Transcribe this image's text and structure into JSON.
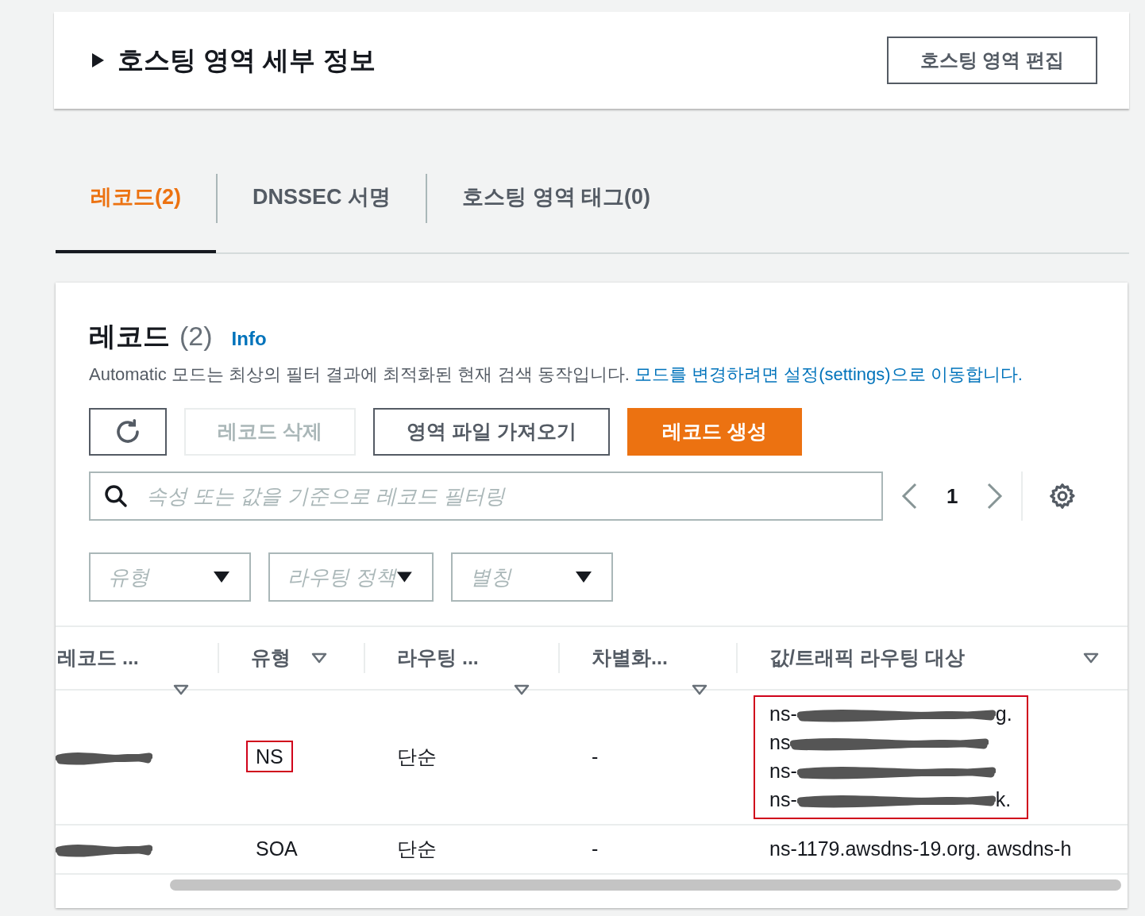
{
  "header": {
    "title": "호스팅 영역 세부 정보",
    "expanded": false,
    "edit_button": "호스팅 영역 편집"
  },
  "tabs": [
    {
      "label": "레코드(2)",
      "selected": true
    },
    {
      "label": "DNSSEC 서명",
      "selected": false
    },
    {
      "label": "호스팅 영역 태그(0)",
      "selected": false
    }
  ],
  "records": {
    "title": "레코드",
    "count": "(2)",
    "info": "Info",
    "description": "Automatic 모드는 최상의 필터 결과에 최적화된 현재 검색 동작입니다.",
    "description_link": "모드를 변경하려면 설정(settings)으로 이동합니다.",
    "buttons": [
      {
        "kind": "refresh",
        "disabled": false
      },
      {
        "kind": "text",
        "label": "레코드 삭제",
        "disabled": true
      },
      {
        "kind": "text",
        "label": "영역 파일 가져오기",
        "disabled": false
      },
      {
        "kind": "primary",
        "label": "레코드 생성",
        "disabled": false
      }
    ],
    "search": {
      "placeholder": "속성 또는 값을 기준으로 레코드 필터링"
    },
    "page": "1",
    "filters": [
      {
        "placeholder": "유형"
      },
      {
        "placeholder": "라우팅 정책"
      },
      {
        "placeholder": "별칭"
      }
    ],
    "columns": [
      {
        "label": "레코드 ..."
      },
      {
        "label": "유형"
      },
      {
        "label": "라우팅 ..."
      },
      {
        "label": "차별화..."
      },
      {
        "label": "값/트래픽 라우팅 대상"
      }
    ],
    "rows": [
      {
        "name_redacted": true,
        "type": "NS",
        "type_highlighted": true,
        "routing": "단순",
        "differentiator": "-",
        "value_highlighted": true,
        "values": [
          {
            "prefix": "ns-",
            "redacted": true,
            "suffix": "g."
          },
          {
            "prefix": "ns",
            "redacted": true
          },
          {
            "prefix": "ns-",
            "redacted": true
          },
          {
            "prefix": "ns-",
            "redacted": true,
            "suffix": "k."
          }
        ]
      },
      {
        "name_redacted": true,
        "type": "SOA",
        "type_highlighted": false,
        "routing": "단순",
        "differentiator": "-",
        "value_highlighted": false,
        "values": [
          {
            "prefix": "ns-1179.awsdns-19.org. awsdns-h",
            "redacted": false
          }
        ]
      }
    ]
  }
}
